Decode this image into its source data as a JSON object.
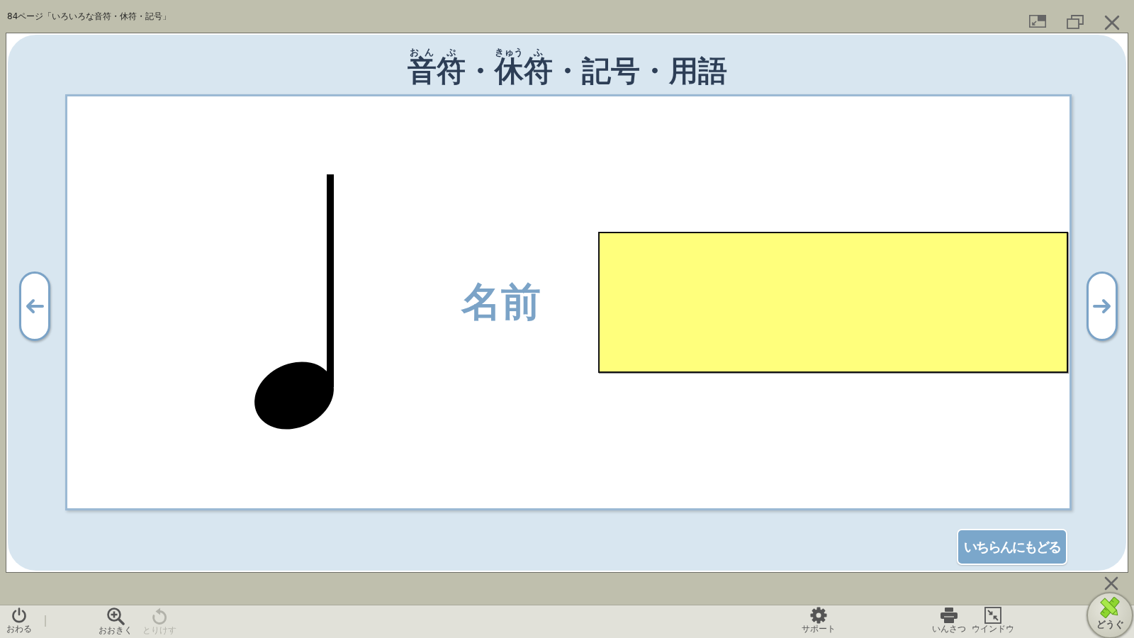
{
  "window": {
    "title": "84ページ「いろいろな音符・休符・記号」"
  },
  "heading": {
    "segments": [
      {
        "text": "音",
        "ruby": "おん"
      },
      {
        "text": "符",
        "ruby": "ぷ"
      },
      {
        "text": "・"
      },
      {
        "text": "休",
        "ruby": "きゅう"
      },
      {
        "text": "符",
        "ruby": "ふ"
      },
      {
        "text": "・記号・用語"
      }
    ]
  },
  "card": {
    "label": "名前"
  },
  "back_button": {
    "label": "いちらんにもどる"
  },
  "toolbar": {
    "groups": [
      [
        {
          "kind": "power",
          "label": "おわる",
          "disabled": false
        }
      ],
      [
        {
          "kind": "zoom_in",
          "label": "おおきく",
          "disabled": false
        },
        {
          "kind": "undo",
          "label": "とりけす",
          "disabled": true
        }
      ],
      [
        {
          "kind": "support",
          "label": "サポート",
          "disabled": false
        }
      ],
      [
        {
          "kind": "print",
          "label": "いんさつ",
          "disabled": false
        },
        {
          "kind": "window",
          "label": "ウインドウ",
          "disabled": false
        }
      ]
    ]
  },
  "tools_button": {
    "label": "どうぐ"
  }
}
